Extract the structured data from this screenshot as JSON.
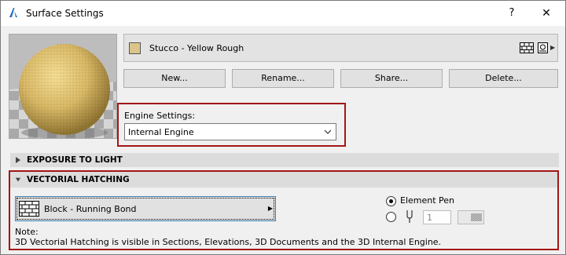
{
  "window": {
    "title": "Surface Settings",
    "help_label": "?",
    "close_label": "✕"
  },
  "material": {
    "name": "Stucco - Yellow Rough",
    "swatch_color": "#dcc58a"
  },
  "buttons": {
    "new": "New...",
    "rename": "Rename...",
    "share": "Share...",
    "delete": "Delete..."
  },
  "engine": {
    "label": "Engine Settings:",
    "selected": "Internal Engine"
  },
  "sections": {
    "exposure": "EXPOSURE TO LIGHT",
    "vectorial": "VECTORIAL HATCHING"
  },
  "hatching": {
    "name": "Block - Running Bond",
    "element_pen_label": "Element Pen",
    "element_pen_selected": true,
    "pen_number": "1",
    "note_label": "Note:",
    "note_text": "3D Vectorial Hatching is visible in Sections, Elevations, 3D Documents and the 3D Internal Engine."
  },
  "colors": {
    "highlight_border": "#a31515",
    "focus_border": "#3c7fb1"
  }
}
